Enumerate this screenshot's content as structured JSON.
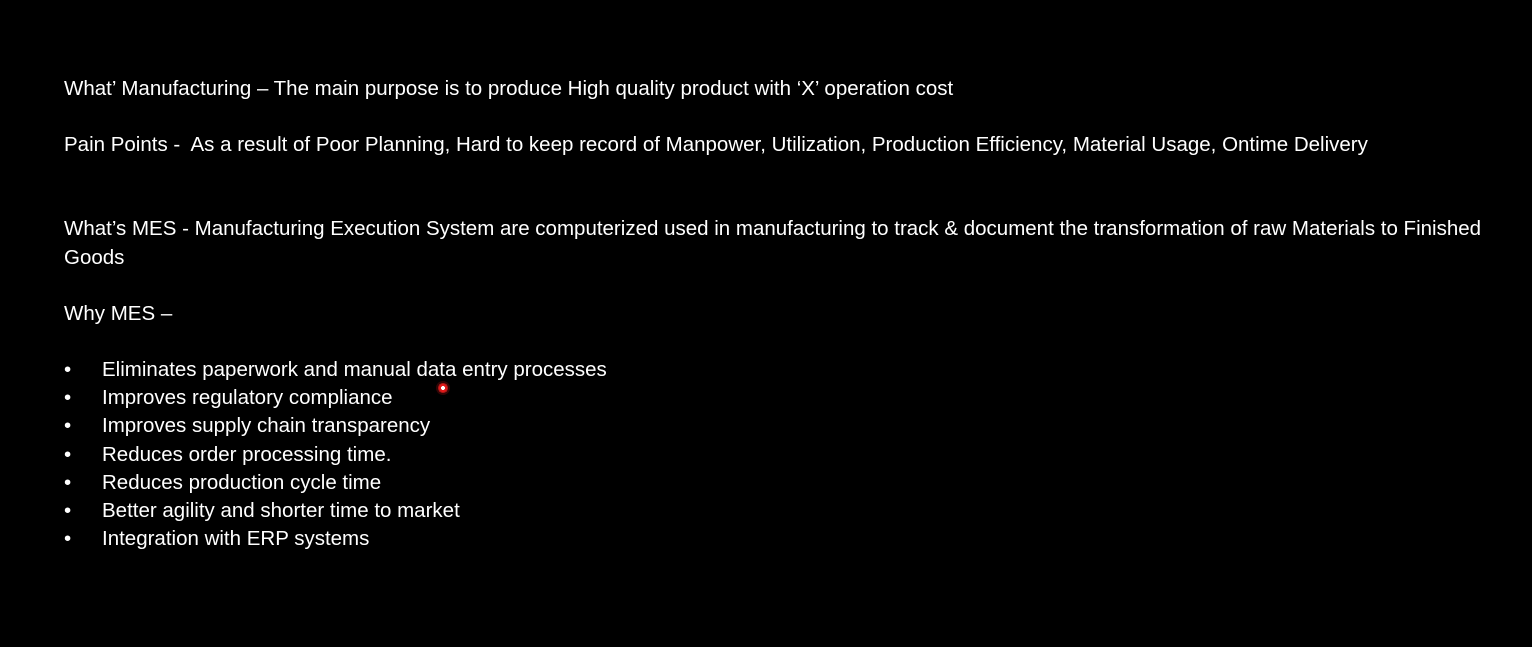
{
  "slide": {
    "what_manufacturing": "What’ Manufacturing – The main purpose is to produce High quality product with ‘X’ operation cost",
    "pain_points": "Pain Points -  As a result of Poor Planning, Hard to keep record of Manpower, Utilization, Production Efficiency, Material Usage, Ontime Delivery",
    "whats_mes": "What’s MES -  Manufacturing Execution System are computerized used in manufacturing  to track & document the transformation of raw Materials to Finished Goods",
    "why_mes": "Why MES –",
    "bullet_symbol": "•",
    "benefits": [
      "Eliminates paperwork and manual data entry processes",
      "Improves regulatory compliance",
      "Improves supply chain transparency",
      "Reduces order processing time.",
      "Reduces production cycle time",
      "Better agility and shorter time to market",
      "Integration with ERP systems"
    ]
  },
  "colors": {
    "background": "#000000",
    "text": "#ffffff",
    "pointer": "#e01818"
  }
}
